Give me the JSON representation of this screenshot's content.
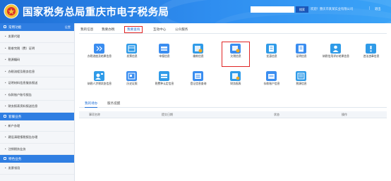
{
  "header": {
    "site_title": "国家税务总局重庆市电子税务局",
    "search_placeholder": "",
    "search_button": "搜索",
    "user_info": "欢迎！重庆市某某实业有限公司",
    "separator": "|",
    "logout": "退出"
  },
  "sidebar": {
    "groups": [
      {
        "title": "常用功能",
        "action": "设置",
        "items": [
          "发票代理",
          "税收完税（费）证明",
          "税源编码",
          "办税流程及税务信息",
          "证明材料信息服务报送",
          "存款账户账号报告",
          "财务报表资料报送信息"
        ]
      },
      {
        "title": "套餐业务",
        "action": "",
        "items": [
          "新户办理",
          "建设清理报税报告办理",
          "注销税务业务"
        ]
      },
      {
        "title": "特色业务",
        "action": "",
        "items": [
          "发票领用"
        ]
      }
    ]
  },
  "main": {
    "tabs": [
      "我的信息",
      "我要办税",
      "我要查询",
      "互动中心",
      "公众服务"
    ],
    "active_tab": "我要查询",
    "tiles_row1": [
      {
        "label": "办税进度及结果信息",
        "icon": "progress-icon",
        "color": "#3a8df0"
      },
      {
        "label": "发票信息",
        "icon": "invoice-icon",
        "color": "#2f9be8"
      },
      {
        "label": "申报信息",
        "icon": "declaration-icon",
        "color": "#3a8df0"
      },
      {
        "label": "缴款信息",
        "icon": "payment-icon",
        "color": "#2f9be8"
      },
      {
        "label": "欠税信息",
        "icon": "arrears-icon",
        "color": "#3a8df0"
      },
      {
        "label": "优惠信息",
        "icon": "preference-icon",
        "color": "#2f9be8"
      },
      {
        "label": "证明信息",
        "icon": "certificate-icon",
        "color": "#3a8df0"
      },
      {
        "label": "纳税信用评价结果信息",
        "icon": "credit-icon",
        "color": "#2f9be8"
      },
      {
        "label": "违法违章信息",
        "icon": "violation-icon",
        "color": "#2f9be8"
      }
    ],
    "tiles_row2": [
      {
        "label": "纳税人涉税状态信息",
        "icon": "status-icon",
        "color": "#2f9be8"
      },
      {
        "label": "历史证照",
        "icon": "history-icon",
        "color": "#3a8df0"
      },
      {
        "label": "税费种认定信息",
        "icon": "tax-type-icon",
        "color": "#2f9be8"
      },
      {
        "label": "登记信息查询",
        "icon": "registration-icon",
        "color": "#3a8df0"
      },
      {
        "label": "财务报表",
        "icon": "report-icon",
        "color": "#2f9be8"
      },
      {
        "label": "存款账户信息",
        "icon": "bank-account-icon",
        "color": "#3a8df0"
      },
      {
        "label": "税源信息",
        "icon": "tax-source-icon",
        "color": "#2f9be8"
      }
    ],
    "highlighted_tile": "欠税信息",
    "sub_tabs": [
      "我的待办",
      "服务提醒"
    ],
    "table_headers": [
      "事项名称",
      "提交日期",
      "状态",
      "操作"
    ]
  },
  "colors": {
    "header_blue": "#1f6fd6",
    "sidebar_group_blue": "#2f7ee2",
    "highlight_red": "#e02424"
  }
}
